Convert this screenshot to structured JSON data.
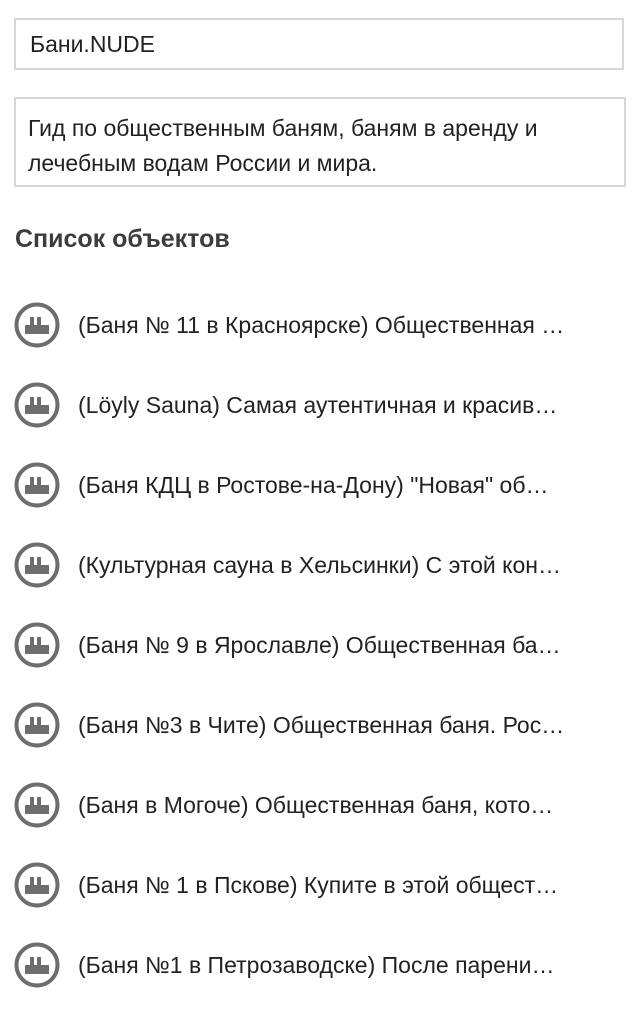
{
  "site": {
    "title": "Бани.NUDE",
    "description": "Гид по общественным баням, баням в аренду и лечебным водам России и мира."
  },
  "objects": {
    "heading": "Список объектов",
    "icon": "bathhouse-icon",
    "items": [
      {
        "label": "(Баня № 11 в Красноярске) Общественная …"
      },
      {
        "label": "(Löyly Sauna) Самая аутентичная и красив…"
      },
      {
        "label": "(Баня КДЦ в Ростове-на-Дону) \"Новая\" об…"
      },
      {
        "label": "(Культурная сауна в Хельсинки) С этой кон…"
      },
      {
        "label": "(Баня № 9 в Ярославле) Общественная ба…"
      },
      {
        "label": "(Баня №3 в Чите) Общественная баня. Рос…"
      },
      {
        "label": "(Баня в Могоче) Общественная баня, кото…"
      },
      {
        "label": "(Баня № 1 в Пскове) Купите в этой общест…"
      },
      {
        "label": "(Баня №1 в Петрозаводске) После парени…"
      }
    ]
  },
  "colors": {
    "icon": "#6d6d6d",
    "border": "#d7d7d7",
    "text": "#222222"
  }
}
